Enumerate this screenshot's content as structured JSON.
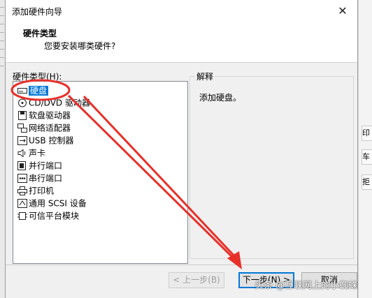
{
  "window": {
    "title": "添加硬件向导",
    "close_glyph": "✕"
  },
  "header": {
    "title": "硬件类型",
    "subtitle": "您要安装哪类硬件?"
  },
  "hardware_list": {
    "label": "硬件类型(H):",
    "items": [
      {
        "label": "硬盘",
        "icon": "hard-disk-icon",
        "selected": true
      },
      {
        "label": "CD/DVD 驱动器",
        "icon": "cd-dvd-icon"
      },
      {
        "label": "软盘驱动器",
        "icon": "floppy-icon"
      },
      {
        "label": "网络适配器",
        "icon": "network-adapter-icon"
      },
      {
        "label": "USB 控制器",
        "icon": "usb-icon"
      },
      {
        "label": "声卡",
        "icon": "sound-card-icon"
      },
      {
        "label": "并行端口",
        "icon": "parallel-port-icon"
      },
      {
        "label": "串行端口",
        "icon": "serial-port-icon"
      },
      {
        "label": "打印机",
        "icon": "printer-icon"
      },
      {
        "label": "通用 SCSI 设备",
        "icon": "scsi-icon"
      },
      {
        "label": "可信平台模块",
        "icon": "tpm-icon"
      }
    ]
  },
  "explanation": {
    "legend": "解释",
    "text": "添加硬盘。"
  },
  "buttons": {
    "back": "< 上一步(B)",
    "next": "下一步(N) >",
    "cancel": "取消"
  },
  "watermark": "头条 @互联网上的小蜘蛛",
  "background_fragments": [
    "印",
    "车",
    "拒"
  ],
  "colors": {
    "selection": "#0078d7",
    "annotation_red": "#e8302a"
  }
}
